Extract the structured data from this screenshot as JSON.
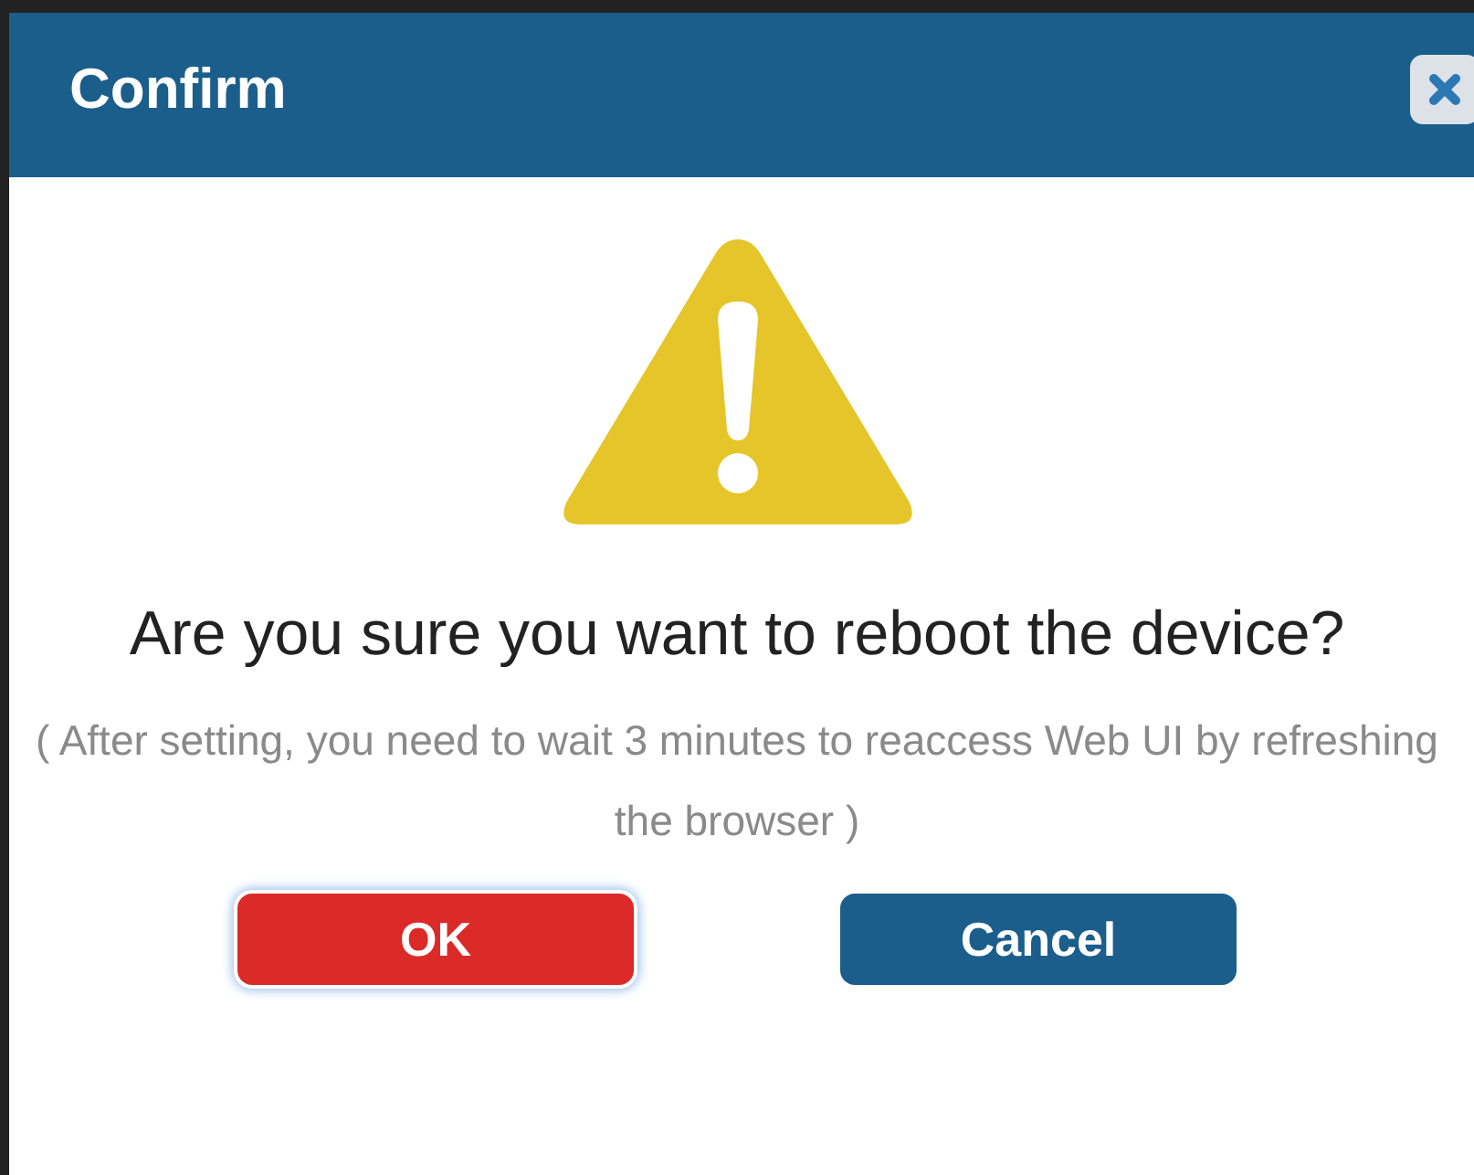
{
  "dialog": {
    "title": "Confirm",
    "message": "Are you sure you want to reboot the device?",
    "note": "( After setting, you need to wait 3 minutes to reaccess Web UI by refreshing the browser )"
  },
  "buttons": [
    {
      "label": "OK",
      "kind": "danger",
      "focused": true
    },
    {
      "label": "Cancel",
      "kind": "primary",
      "focused": false
    }
  ]
}
